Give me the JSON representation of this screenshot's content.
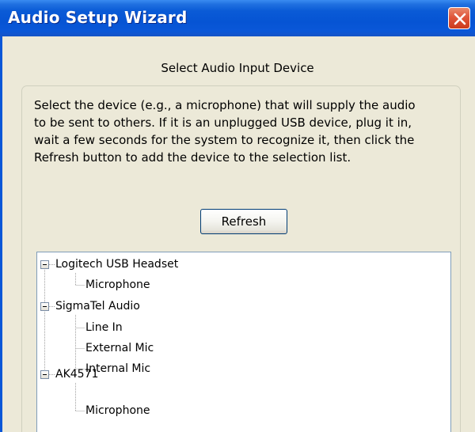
{
  "window": {
    "title": "Audio Setup Wizard"
  },
  "page": {
    "subtitle": "Select Audio Input Device",
    "instructions": [
      "Select the device (e.g., a microphone) that will supply the audio",
      "to be sent to others.  If it is an unplugged USB device, plug it in,",
      "wait a few seconds for the system to recognize it, then click the",
      "Refresh button to add the device to the selection list."
    ],
    "refresh_label": "Refresh"
  },
  "device_tree": [
    {
      "label": "Logitech USB Headset",
      "expanded": true,
      "children": [
        "Microphone"
      ]
    },
    {
      "label": "SigmaTel Audio",
      "expanded": true,
      "children": [
        "Line In",
        "External Mic",
        "Internal Mic"
      ]
    },
    {
      "label": "AK4571",
      "expanded": true,
      "children": [
        "Microphone"
      ]
    }
  ],
  "colors": {
    "title_bar": "#0654d4",
    "close_button": "#e0553a",
    "dialog_background": "#ece9d8",
    "list_border": "#7f9db9"
  },
  "icons": {
    "close": "close-icon",
    "collapse": "minus-toggle-icon"
  }
}
